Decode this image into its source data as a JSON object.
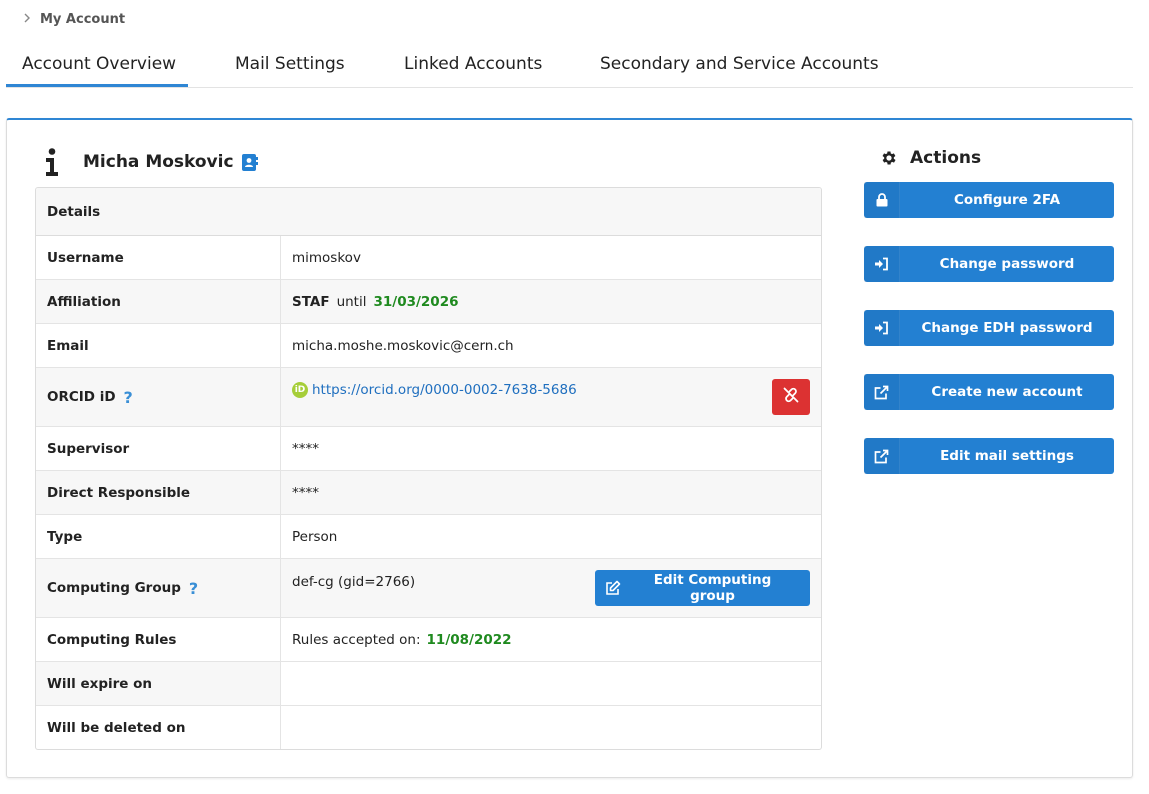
{
  "breadcrumb": {
    "label": "My Account"
  },
  "tabs": [
    {
      "label": "Account Overview",
      "active": true
    },
    {
      "label": "Mail Settings"
    },
    {
      "label": "Linked Accounts"
    },
    {
      "label": "Secondary and Service Accounts"
    }
  ],
  "person": {
    "name": "Micha Moskovic"
  },
  "details": {
    "header": "Details",
    "username": {
      "label": "Username",
      "value": "mimoskov"
    },
    "affiliation": {
      "label": "Affiliation",
      "code": "STAF",
      "until_label": "until",
      "until_date": "31/03/2026"
    },
    "email": {
      "label": "Email",
      "value": "micha.moshe.moskovic@cern.ch"
    },
    "orcid": {
      "label": "ORCID iD",
      "help": "?",
      "badge": "iD",
      "url": "https://orcid.org/0000-0002-7638-5686"
    },
    "supervisor": {
      "label": "Supervisor",
      "value": "****"
    },
    "direct_responsible": {
      "label": "Direct Responsible",
      "value": "****"
    },
    "type": {
      "label": "Type",
      "value": "Person"
    },
    "computing_group": {
      "label": "Computing Group",
      "help": "?",
      "value": "def-cg (gid=2766)",
      "button": "Edit Computing group"
    },
    "computing_rules": {
      "label": "Computing Rules",
      "prefix": "Rules accepted on:",
      "date": "11/08/2022"
    },
    "expire": {
      "label": "Will expire on",
      "value": ""
    },
    "deleted": {
      "label": "Will be deleted on",
      "value": ""
    }
  },
  "actions": {
    "title": "Actions",
    "buttons": [
      {
        "label": "Configure 2FA",
        "icon": "lock-icon"
      },
      {
        "label": "Change password",
        "icon": "sign-in-icon"
      },
      {
        "label": "Change EDH password",
        "icon": "sign-in-icon"
      },
      {
        "label": "Create new account",
        "icon": "external-link-icon"
      },
      {
        "label": "Edit mail settings",
        "icon": "external-link-icon"
      }
    ]
  },
  "colors": {
    "accent": "#2380d2",
    "danger": "#dc3232",
    "success": "#1f8a1f",
    "orcid": "#a6ce39"
  }
}
